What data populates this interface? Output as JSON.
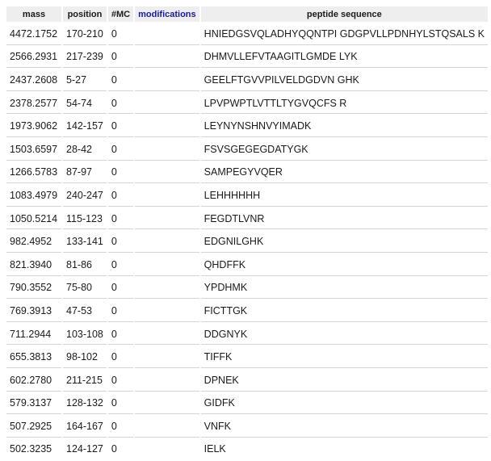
{
  "table": {
    "headers": {
      "mass": "mass",
      "position": "position",
      "mc": "#MC",
      "modifications": "modifications",
      "sequence": "peptide sequence"
    },
    "rows": [
      {
        "mass": "4472.1752",
        "position": "170-210",
        "mc": "0",
        "modifications": "",
        "sequence": "HNIEDGSVQLADHYQQNTPI GDGPVLLPDNHYLSTQSALS K"
      },
      {
        "mass": "2566.2931",
        "position": "217-239",
        "mc": "0",
        "modifications": "",
        "sequence": "DHMVLLEFVTAAGITLGMDE LYK"
      },
      {
        "mass": "2437.2608",
        "position": "5-27",
        "mc": "0",
        "modifications": "",
        "sequence": "GEELFTGVVPILVELDGDVN GHK"
      },
      {
        "mass": "2378.2577",
        "position": "54-74",
        "mc": "0",
        "modifications": "",
        "sequence": "LPVPWPTLVTTLTYGVQCFS R"
      },
      {
        "mass": "1973.9062",
        "position": "142-157",
        "mc": "0",
        "modifications": "",
        "sequence": "LEYNYNSHNVYIMADK"
      },
      {
        "mass": "1503.6597",
        "position": "28-42",
        "mc": "0",
        "modifications": "",
        "sequence": "FSVSGEGEGDATYGK"
      },
      {
        "mass": "1266.5783",
        "position": "87-97",
        "mc": "0",
        "modifications": "",
        "sequence": "SAMPEGYVQER"
      },
      {
        "mass": "1083.4979",
        "position": "240-247",
        "mc": "0",
        "modifications": "",
        "sequence": "LEHHHHHH"
      },
      {
        "mass": "1050.5214",
        "position": "115-123",
        "mc": "0",
        "modifications": "",
        "sequence": "FEGDTLVNR"
      },
      {
        "mass": "982.4952",
        "position": "133-141",
        "mc": "0",
        "modifications": "",
        "sequence": "EDGNILGHK"
      },
      {
        "mass": "821.3940",
        "position": "81-86",
        "mc": "0",
        "modifications": "",
        "sequence": "QHDFFK"
      },
      {
        "mass": "790.3552",
        "position": "75-80",
        "mc": "0",
        "modifications": "",
        "sequence": "YPDHMK"
      },
      {
        "mass": "769.3913",
        "position": "47-53",
        "mc": "0",
        "modifications": "",
        "sequence": "FICTTGK"
      },
      {
        "mass": "711.2944",
        "position": "103-108",
        "mc": "0",
        "modifications": "",
        "sequence": "DDGNYK"
      },
      {
        "mass": "655.3813",
        "position": "98-102",
        "mc": "0",
        "modifications": "",
        "sequence": "TIFFK"
      },
      {
        "mass": "602.2780",
        "position": "211-215",
        "mc": "0",
        "modifications": "",
        "sequence": "DPNEK"
      },
      {
        "mass": "579.3137",
        "position": "128-132",
        "mc": "0",
        "modifications": "",
        "sequence": "GIDFK"
      },
      {
        "mass": "507.2925",
        "position": "164-167",
        "mc": "0",
        "modifications": "",
        "sequence": "VNFK"
      },
      {
        "mass": "502.3235",
        "position": "124-127",
        "mc": "0",
        "modifications": "",
        "sequence": "IELK"
      }
    ]
  }
}
